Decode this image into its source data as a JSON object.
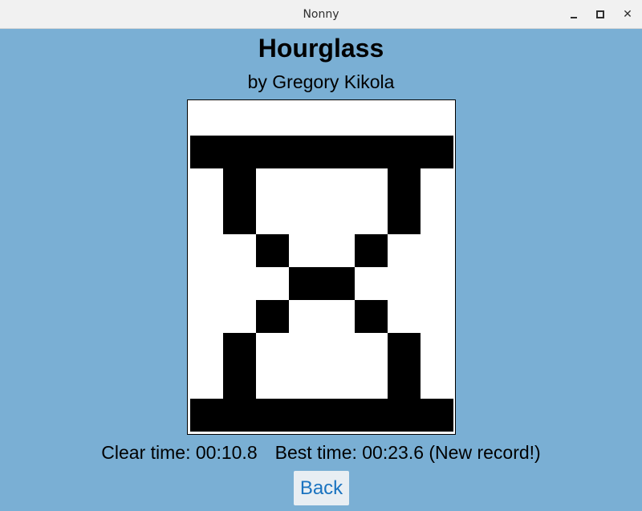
{
  "window": {
    "title": "Nonny",
    "controls": {
      "minimize_icon": "minimize-icon",
      "maximize_icon": "maximize-icon",
      "close_icon": "close-icon",
      "close_glyph": "✕"
    }
  },
  "puzzle": {
    "title": "Hourglass",
    "author": "by Gregory Kikola",
    "solution": [
      "00000000",
      "11111111",
      "01000010",
      "01000010",
      "00100100",
      "00011000",
      "00100100",
      "01000010",
      "01000010",
      "11111111"
    ]
  },
  "results": {
    "clear_time": "Clear time: 00:10.8",
    "best_time": "Best time: 00:23.6 (New record!)"
  },
  "actions": {
    "back_label": "Back"
  },
  "colors": {
    "background": "#7aafd4",
    "filled_cell": "#000000",
    "empty_cell": "#ffffff",
    "link_text": "#1a73c0"
  }
}
